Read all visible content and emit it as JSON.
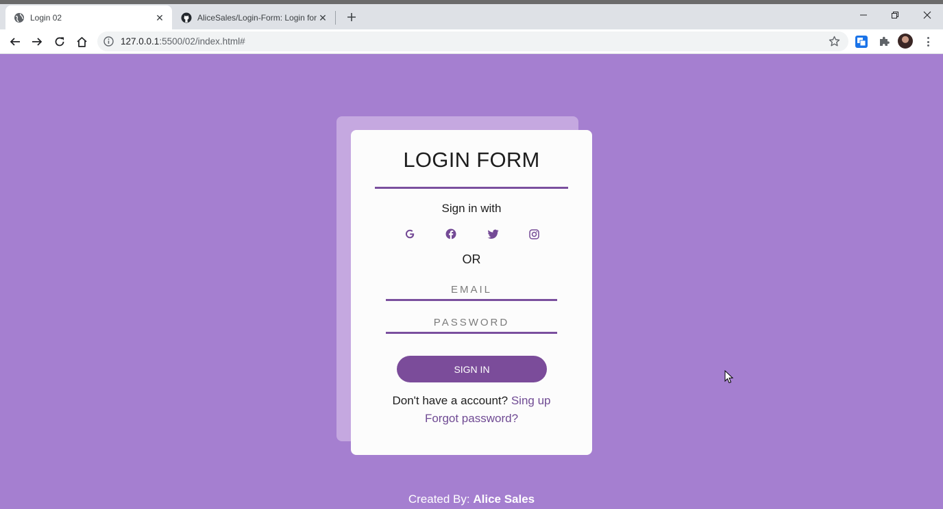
{
  "browser": {
    "tabs": [
      {
        "title": "Login 02",
        "active": true,
        "icon": "globe-icon"
      },
      {
        "title": "AliceSales/Login-Form: Login for",
        "active": false,
        "icon": "github-icon"
      }
    ],
    "address": {
      "host": "127.0.0.1",
      "path": ":5500/02/index.html#"
    }
  },
  "page": {
    "title": "LOGIN FORM",
    "sign_in_with": "Sign in with",
    "social_icons": [
      "google-icon",
      "facebook-icon",
      "twitter-icon",
      "instagram-icon"
    ],
    "or_label": "OR",
    "email_placeholder": "EMAIL",
    "password_placeholder": "PASSWORD",
    "sign_in_button": "SIGN IN",
    "account_prompt": "Don't have a account?",
    "signup_link": "Sing up",
    "forgot_link": "Forgot password?",
    "footer_prefix": "Created By:",
    "footer_author": "Alice Sales"
  },
  "colors": {
    "background": "#a57fd0",
    "accent": "#7b4c9a",
    "card": "#fcfcfc"
  }
}
